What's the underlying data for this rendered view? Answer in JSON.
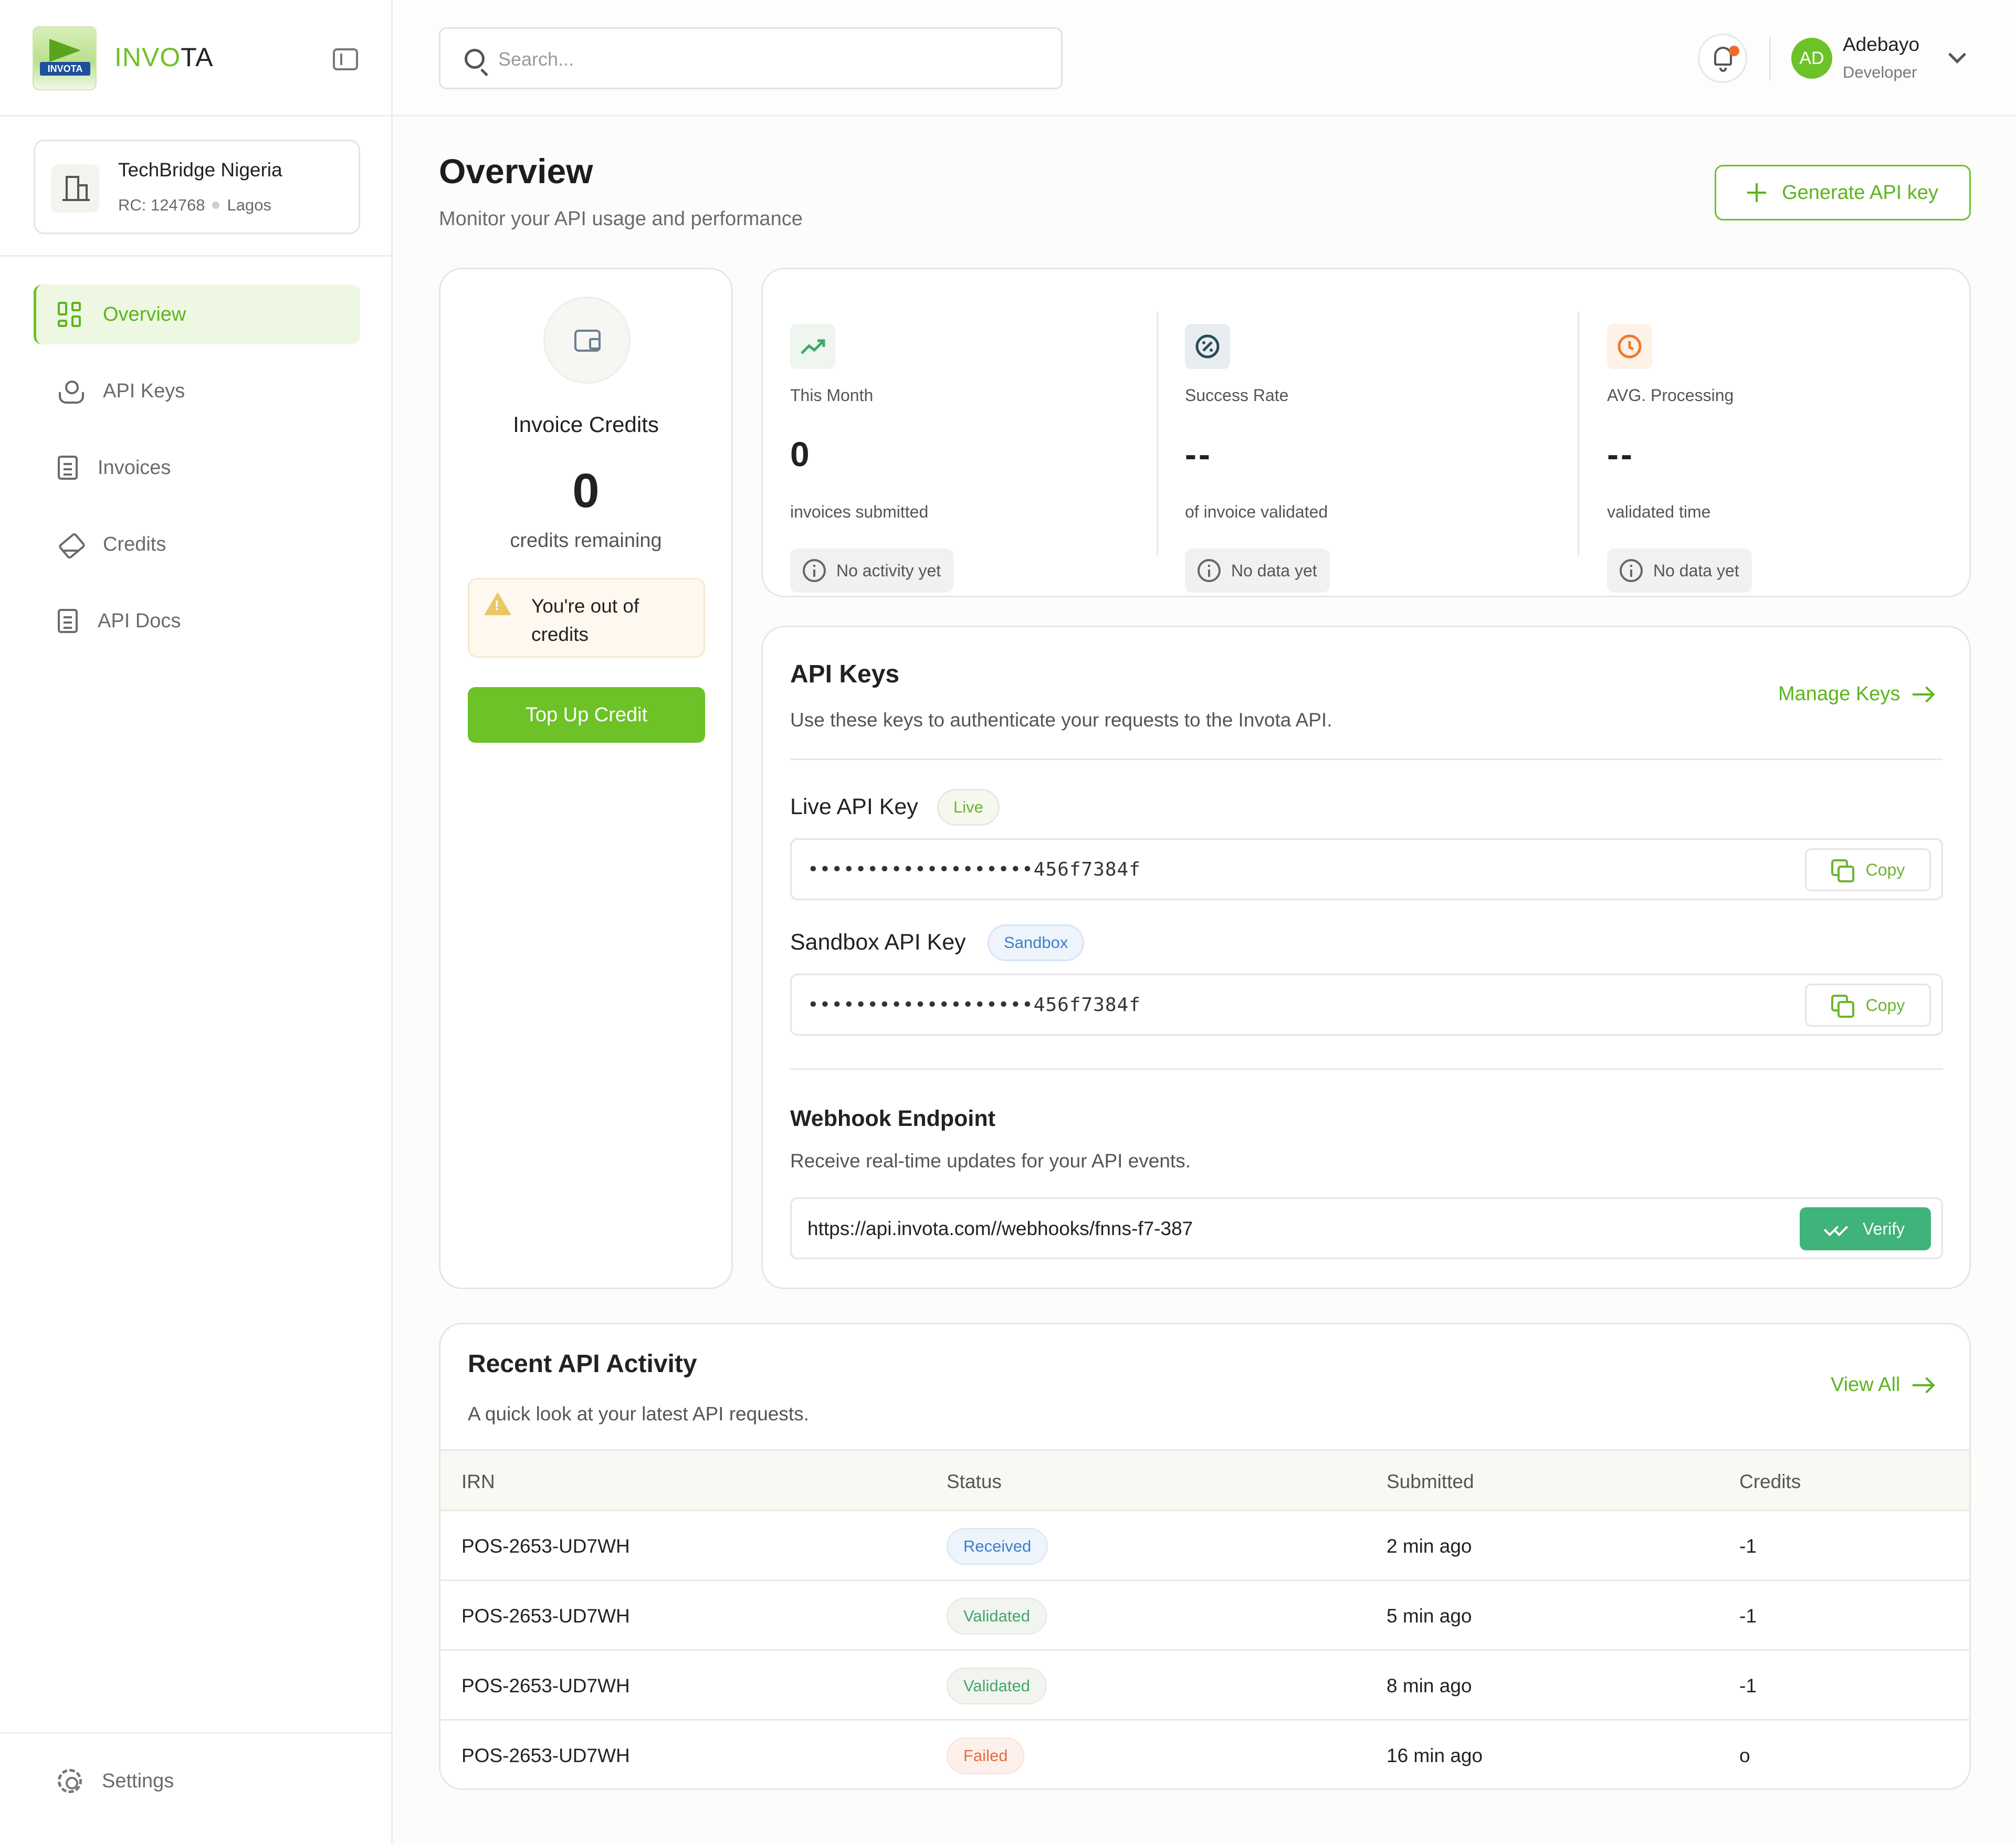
{
  "brand": {
    "name_prefix": "INVO",
    "name_suffix": "TA",
    "logo_text": "INVOTA"
  },
  "org": {
    "name": "TechBridge Nigeria",
    "rc": "RC: 124768",
    "location": "Lagos"
  },
  "sidebar": {
    "items": [
      {
        "label": "Overview",
        "icon": "dashboard-grid-icon",
        "active": true
      },
      {
        "label": "API Keys",
        "icon": "webhook-icon",
        "active": false
      },
      {
        "label": "Invoices",
        "icon": "receipt-icon",
        "active": false
      },
      {
        "label": "Credits",
        "icon": "tag-icon",
        "active": false
      },
      {
        "label": "API Docs",
        "icon": "document-icon",
        "active": false
      }
    ],
    "settings_label": "Settings"
  },
  "header": {
    "search_placeholder": "Search...",
    "user": {
      "initials": "AD",
      "name": "Adebayo",
      "role": "Developer"
    }
  },
  "page": {
    "title": "Overview",
    "subtitle": "Monitor your API usage and performance",
    "generate_label": "Generate API key"
  },
  "credits": {
    "title": "Invoice Credits",
    "value": "0",
    "label": "credits remaining",
    "warning": "You're out of credits",
    "topup_label": "Top Up Credit"
  },
  "stats": [
    {
      "label": "This Month",
      "value": "0",
      "caption": "invoices submitted",
      "pill": "No activity yet",
      "icon": "trending-up-icon",
      "color": "#3fa86a"
    },
    {
      "label": "Success Rate",
      "value": "--",
      "caption": "of invoice validated",
      "pill": "No data yet",
      "icon": "percent-badge-icon",
      "color": "#2a4a5a"
    },
    {
      "label": "AVG. Processing",
      "value": "--",
      "caption": "validated time",
      "pill": "No data yet",
      "icon": "clock-icon",
      "color": "#f07a2a"
    }
  ],
  "api_keys": {
    "title": "API Keys",
    "subtitle": "Use these keys to authenticate your requests to the Invota API.",
    "manage_label": "Manage Keys",
    "live": {
      "label": "Live API Key",
      "badge": "Live",
      "value": "•••••••••••••••••••456f7384f",
      "copy_label": "Copy"
    },
    "sandbox": {
      "label": "Sandbox API Key",
      "badge": "Sandbox",
      "value": "•••••••••••••••••••456f7384f",
      "copy_label": "Copy"
    },
    "webhook": {
      "title": "Webhook Endpoint",
      "subtitle": "Receive real-time updates for your API events.",
      "url": "https://api.invota.com//webhooks/fnns-f7-387",
      "verify_label": "Verify"
    }
  },
  "activity": {
    "title": "Recent API Activity",
    "subtitle": "A quick look at your latest API requests.",
    "view_all_label": "View All",
    "columns": [
      "IRN",
      "Status",
      "Submitted",
      "Credits"
    ],
    "rows": [
      {
        "irn": "POS-2653-UD7WH",
        "status": "Received",
        "submitted": "2 min ago",
        "credits": "-1"
      },
      {
        "irn": "POS-2653-UD7WH",
        "status": "Validated",
        "submitted": "5 min ago",
        "credits": "-1"
      },
      {
        "irn": "POS-2653-UD7WH",
        "status": "Validated",
        "submitted": "8 min ago",
        "credits": "-1"
      },
      {
        "irn": "POS-2653-UD7WH",
        "status": "Failed",
        "submitted": "16 min ago",
        "credits": "o"
      }
    ]
  },
  "colors": {
    "accent": "#6cc227",
    "verify": "#3fb37a",
    "failed": "#e46b44",
    "received": "#3c7fc8"
  }
}
